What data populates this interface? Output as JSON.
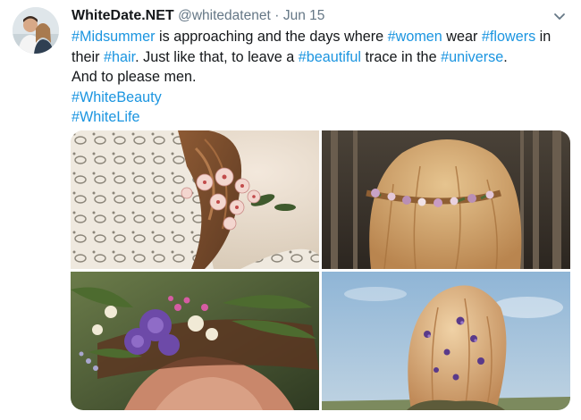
{
  "tweet": {
    "display_name": "WhiteDate.NET",
    "handle": "@whitedatenet",
    "separator": "·",
    "date": "Jun 15",
    "lines": [
      [
        {
          "t": "#Midsummer",
          "tag": true
        },
        {
          "t": " is approaching and the days where ",
          "tag": false
        },
        {
          "t": "#women",
          "tag": true
        },
        {
          "t": " wear ",
          "tag": false
        },
        {
          "t": "#flowers",
          "tag": true
        },
        {
          "t": " in",
          "tag": false
        }
      ],
      [
        {
          "t": "their ",
          "tag": false
        },
        {
          "t": "#hair",
          "tag": true
        },
        {
          "t": ". Just like that, to leave a ",
          "tag": false
        },
        {
          "t": "#beautiful",
          "tag": true
        },
        {
          "t": " trace in the ",
          "tag": false
        },
        {
          "t": "#universe",
          "tag": true
        },
        {
          "t": ".",
          "tag": false
        }
      ],
      [
        {
          "t": "And to please men.",
          "tag": false
        }
      ],
      [
        {
          "t": "#WhiteBeauty",
          "tag": true
        }
      ],
      [
        {
          "t": "#WhiteLife",
          "tag": true
        }
      ]
    ]
  },
  "icons": {
    "menu": "chevron-down-icon"
  },
  "colors": {
    "text": "#14171a",
    "secondary": "#657786",
    "link": "#1b95e0"
  }
}
